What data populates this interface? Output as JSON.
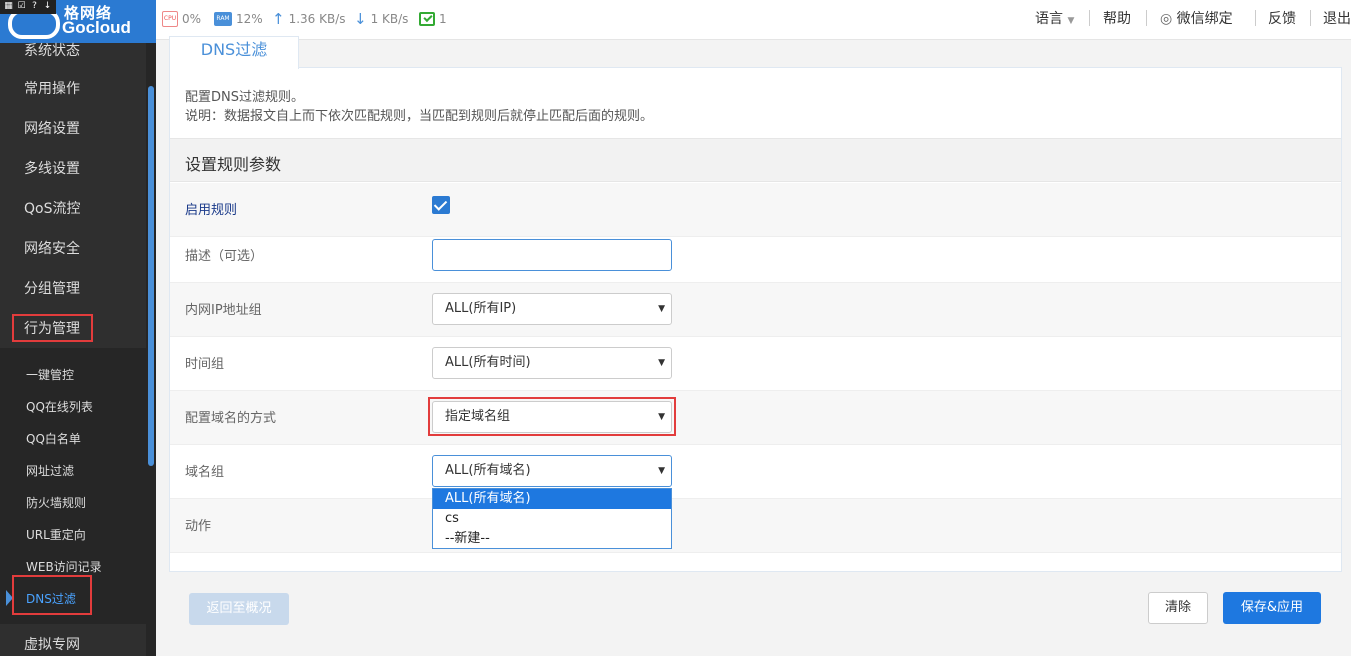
{
  "brand": {
    "name_cn": "格网络",
    "name_en": "Gocloud"
  },
  "status": {
    "cpu_icon": "CPU",
    "cpu": "0%",
    "ram_icon": "RAM",
    "ram": "12%",
    "upload": "1.36 KB/s",
    "download": "1 KB/s",
    "online_count": "1"
  },
  "topnav": {
    "language": "语言",
    "help": "帮助",
    "wechat_bind": "微信绑定",
    "feedback": "反馈",
    "logout": "退出"
  },
  "sidebar": {
    "items": [
      "系统状态",
      "常用操作",
      "网络设置",
      "多线设置",
      "QoS流控",
      "网络安全",
      "分组管理",
      "行为管理",
      "虚拟专网"
    ],
    "sub_items": [
      "一键管控",
      "QQ在线列表",
      "QQ白名单",
      "网址过滤",
      "防火墙规则",
      "URL重定向",
      "WEB访问记录",
      "DNS过滤"
    ],
    "active_sub": "DNS过滤"
  },
  "page": {
    "tab": "DNS过滤",
    "desc1": "配置DNS过滤规则。",
    "desc2": "说明：数据报文自上而下依次匹配规则，当匹配到规则后就停止匹配后面的规则。",
    "section_title": "设置规则参数"
  },
  "form": {
    "enable_label": "启用规则",
    "enable_checked": true,
    "desc_label": "描述（可选）",
    "desc_value": "",
    "ip_group_label": "内网IP地址组",
    "ip_group_value": "ALL(所有IP)",
    "time_group_label": "时间组",
    "time_group_value": "ALL(所有时间)",
    "domain_mode_label": "配置域名的方式",
    "domain_mode_value": "指定域名组",
    "domain_group_label": "域名组",
    "domain_group_value": "ALL(所有域名)",
    "domain_group_options": [
      "ALL(所有域名)",
      "cs",
      "--新建--"
    ],
    "action_label": "动作"
  },
  "buttons": {
    "back": "返回至概况",
    "clear": "清除",
    "save": "保存&应用"
  },
  "colors": {
    "accent": "#1e78e0",
    "highlight": "#e23c3c",
    "sidebar": "#2f2f2f"
  }
}
